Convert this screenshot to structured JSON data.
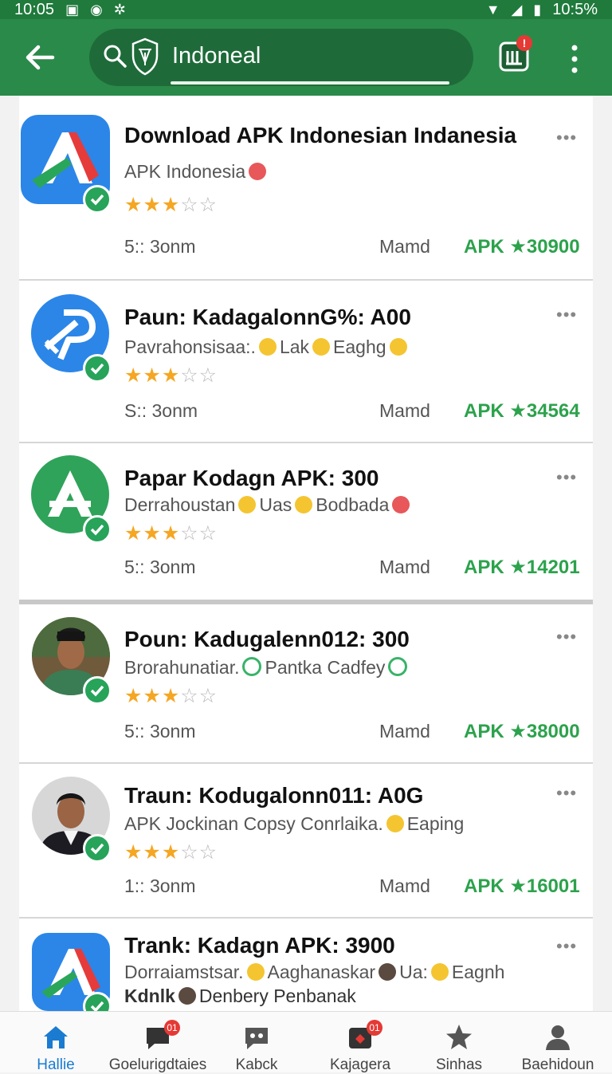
{
  "status_bar": {
    "time_left": "10:05",
    "time_right": "10:5%"
  },
  "search": {
    "value": "Indoneal"
  },
  "header": {
    "inbox_badge": "!"
  },
  "items": [
    {
      "title": "Download APK Indonesian Indanesia",
      "subtitle": "APK Indonesia",
      "rating": 3,
      "meta": "5:: 3onm",
      "meta2": "Mamd",
      "apk_label": "APK",
      "count": "30900"
    },
    {
      "title": "Paun: KadagalonnG%: A00",
      "subtitle_parts": [
        "Pavrahonsisaa:.",
        "Lak",
        "Eaghg"
      ],
      "rating": 3,
      "meta": "S:: 3onm",
      "meta2": "Mamd",
      "apk_label": "APK",
      "count": "34564"
    },
    {
      "title": "Papar Kodagn APK: 300",
      "subtitle_parts": [
        "Derrahoustan",
        "Uas",
        "Bodbada"
      ],
      "rating": 3,
      "meta": "5:: 3onm",
      "meta2": "Mamd",
      "apk_label": "APK",
      "count": "14201"
    },
    {
      "title": "Poun: Kadugalenn012: 300",
      "subtitle_parts": [
        "Brorahunatiar.",
        "Pantka Cadfey"
      ],
      "rating": 3,
      "meta": "5:: 3onm",
      "meta2": "Mamd",
      "apk_label": "APK",
      "count": "38000"
    },
    {
      "title": "Traun: Kodugalonn011: A0G",
      "subtitle_parts": [
        "APK Jockinan Copsy Conrlaika.",
        "Eaping"
      ],
      "rating": 3,
      "meta": "1:: 3onm",
      "meta2": "Mamd",
      "apk_label": "APK",
      "count": "16001"
    },
    {
      "title": "Trank: Kadagn APK: 3900",
      "subtitle_parts": [
        "Dorraiamstsar.",
        "Aaghanaskar",
        "Ua:",
        "Eagnh"
      ],
      "subtitle2_parts": [
        "Kdnlk",
        "Denbery Penbanak"
      ]
    }
  ],
  "nav": [
    {
      "label": "Hallie",
      "badge": ""
    },
    {
      "label": "Goelurigdtaies",
      "badge": "01"
    },
    {
      "label": "Kabck",
      "badge": ""
    },
    {
      "label": "Kajagera",
      "badge": "01"
    },
    {
      "label": "Sinhas",
      "badge": ""
    },
    {
      "label": "Baehidoun",
      "badge": ""
    }
  ],
  "icons": {
    "app_bar": [
      "back-arrow-icon",
      "search-icon",
      "shield-icon",
      "inbox-icon",
      "more-vert-icon"
    ],
    "nav": [
      "home-icon",
      "chat-icon",
      "chat-bubble-icon",
      "tag-icon",
      "star-icon",
      "person-icon"
    ]
  },
  "colors": {
    "app_bar": "#2a8a4a",
    "apk_green": "#2ca24c",
    "star": "#f5a623",
    "active_nav": "#1a7bd1",
    "badge": "#e53935"
  }
}
